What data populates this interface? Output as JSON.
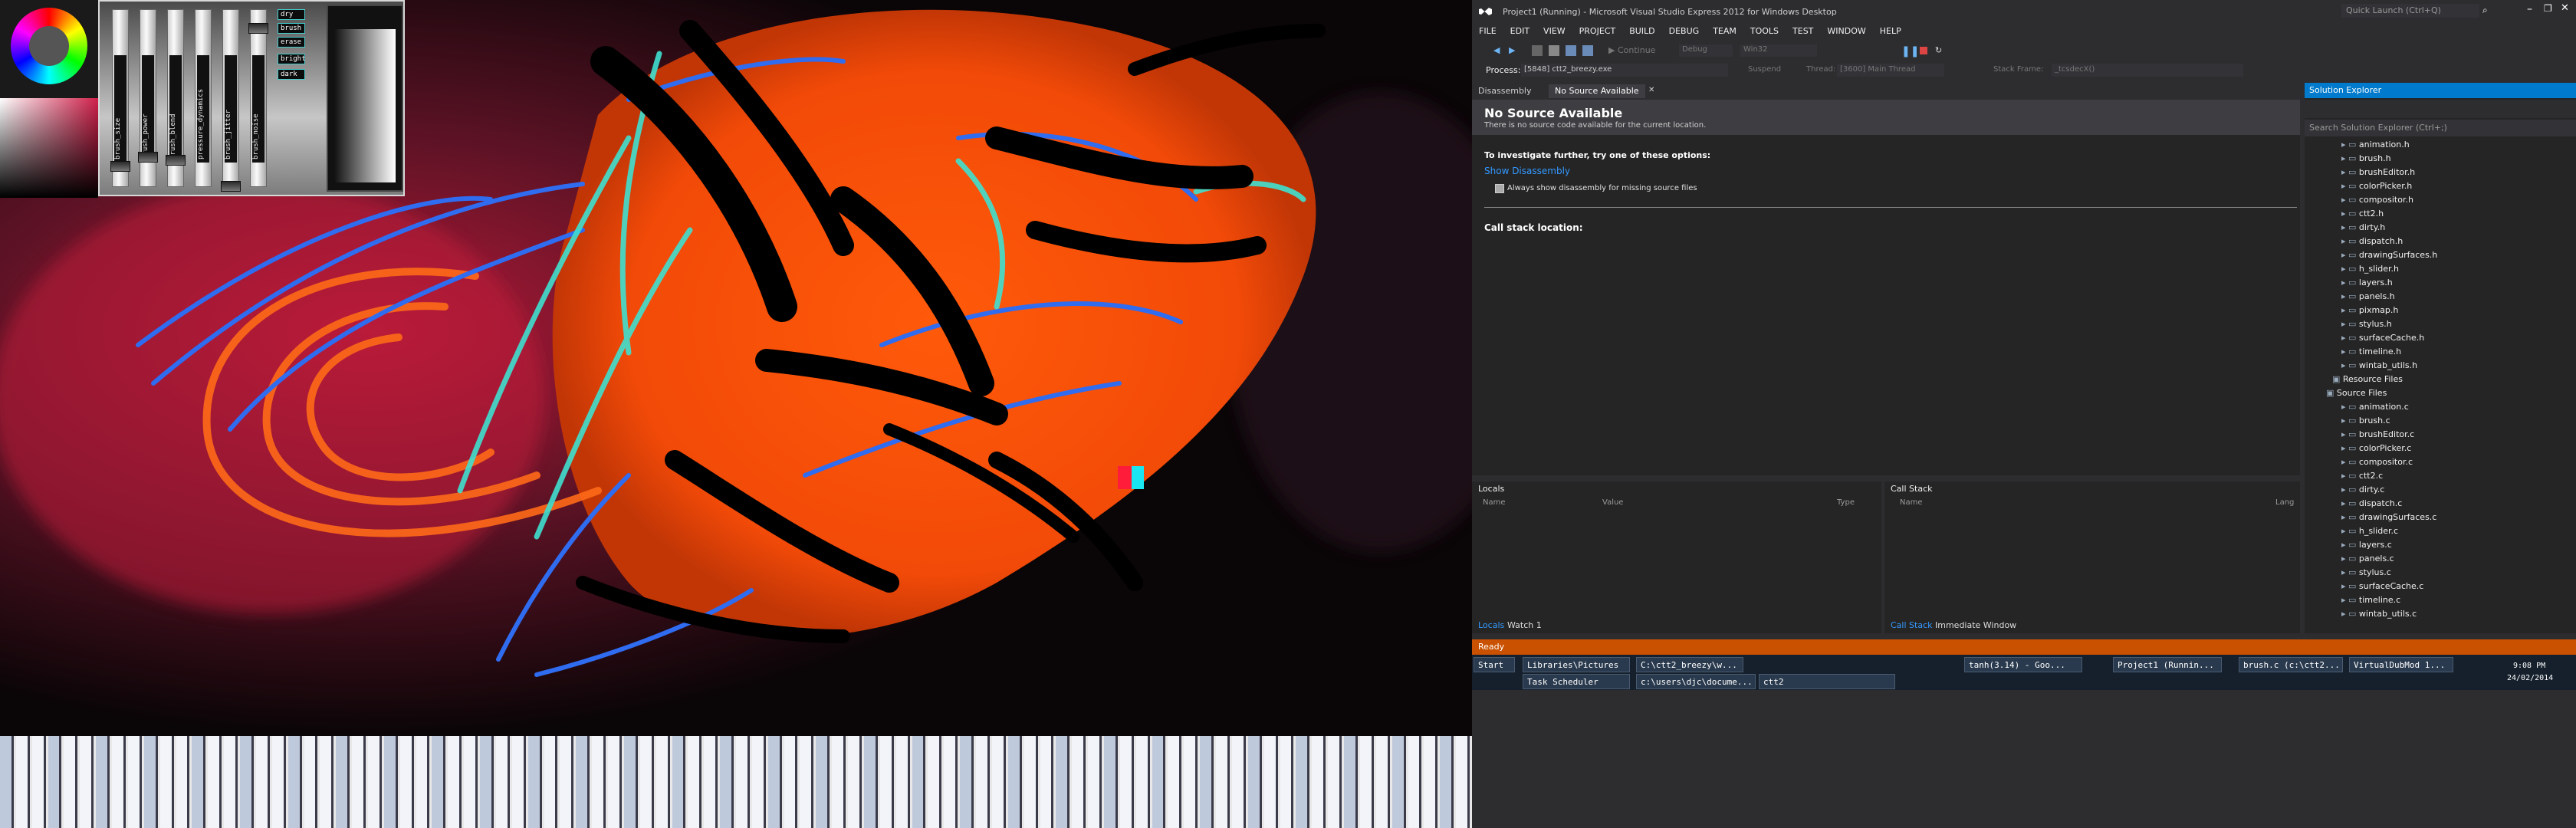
{
  "paint_app": {
    "slider_labels": [
      "brush_size",
      "brush_power",
      "brush_blend",
      "pressure_dynamics",
      "brush_jitter",
      "brush_noise"
    ],
    "mode_buttons": [
      "dry",
      "brush",
      "erase",
      "bright",
      "dark"
    ],
    "colors": {
      "red_square": "#ff1b3a",
      "cyan_square": "#19e6f0"
    }
  },
  "vs": {
    "title": "Project1 (Running) - Microsoft Visual Studio Express 2012 for Windows Desktop",
    "quick_launch_placeholder": "Quick Launch (Ctrl+Q)",
    "menu": [
      "FILE",
      "EDIT",
      "VIEW",
      "PROJECT",
      "BUILD",
      "DEBUG",
      "TEAM",
      "TOOLS",
      "TEST",
      "WINDOW",
      "HELP"
    ],
    "toolbar": {
      "continue": "Continue",
      "config": "Debug",
      "platform": "Win32"
    },
    "process_bar": {
      "process_label": "Process:",
      "process_value": "[5848] ctt2_breezy.exe",
      "suspend": "Suspend",
      "thread_label": "Thread:",
      "thread_value": "[3600] Main Thread",
      "stack_label": "Stack Frame:",
      "stack_value": "_tcsdecX()"
    },
    "doc_tabs": [
      "Disassembly",
      "No Source Available"
    ],
    "doc": {
      "heading": "No Source Available",
      "subheading": "There is no source code available for the current location.",
      "investigate": "To investigate further, try one of these options:",
      "link": "Show Disassembly",
      "checkbox": "Always show disassembly for missing source files",
      "callstack_location": "Call stack location:"
    },
    "locals": {
      "title": "Locals",
      "columns": [
        "Name",
        "Value",
        "Type"
      ],
      "tabs": [
        "Locals",
        "Watch 1"
      ]
    },
    "callstack": {
      "title": "Call Stack",
      "columns": [
        "Name",
        "Lang"
      ],
      "tabs": [
        "Call Stack",
        "Immediate Window"
      ]
    },
    "solution_explorer": {
      "title": "Solution Explorer",
      "search_placeholder": "Search Solution Explorer (Ctrl+;)",
      "headers": [
        "animation.h",
        "brush.h",
        "brushEditor.h",
        "colorPicker.h",
        "compositor.h",
        "ctt2.h",
        "dirty.h",
        "dispatch.h",
        "drawingSurfaces.h",
        "h_slider.h",
        "layers.h",
        "panels.h",
        "pixmap.h",
        "stylus.h",
        "surfaceCache.h",
        "timeline.h",
        "wintab_utils.h"
      ],
      "resource_folder": "Resource Files",
      "source_folder": "Source Files",
      "sources": [
        "animation.c",
        "brush.c",
        "brushEditor.c",
        "colorPicker.c",
        "compositor.c",
        "ctt2.c",
        "dirty.c",
        "dispatch.c",
        "drawingSurfaces.c",
        "h_slider.c",
        "layers.c",
        "panels.c",
        "stylus.c",
        "surfaceCache.c",
        "timeline.c",
        "wintab_utils.c"
      ]
    },
    "status": "Ready",
    "accent_colors": {
      "blue": "#007acc",
      "status_orange": "#ca5100"
    }
  },
  "taskbar": {
    "start": "Start",
    "row1": [
      "Libraries\\Pictures",
      "C:\\ctt2_breezy\\w...",
      "tanh(3.14) - Goo...",
      "Project1 (Runnin...",
      "brush.c (c:\\ctt2...",
      "VirtualDubMod 1..."
    ],
    "row2": [
      "Task Scheduler",
      "c:\\users\\djc\\docume...",
      "ctt2"
    ],
    "time": "9:08 PM",
    "date": "24/02/2014"
  }
}
